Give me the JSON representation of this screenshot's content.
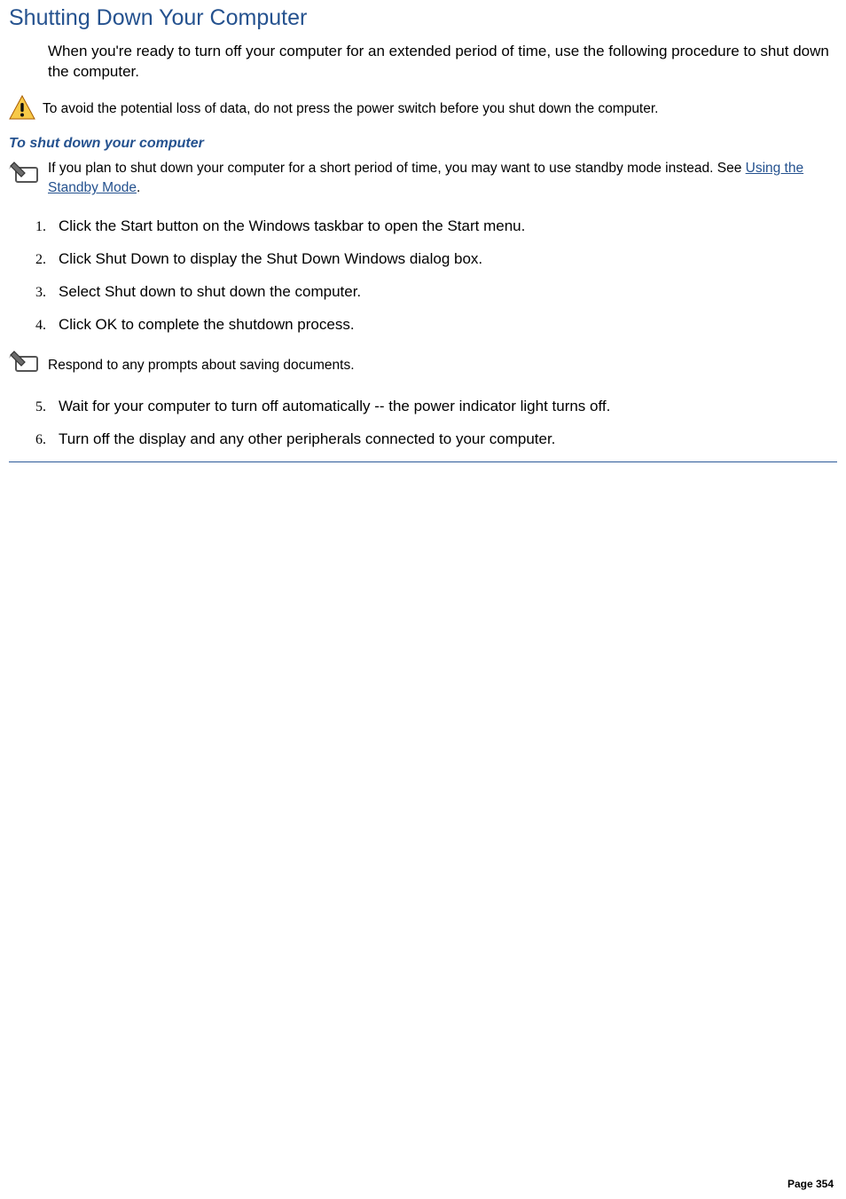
{
  "title": "Shutting Down Your Computer",
  "intro": "When you're ready to turn off your computer for an extended period of time, use the following procedure to shut down the computer.",
  "warning_text": "To avoid the potential loss of data, do not press the power switch before you shut down the computer.",
  "subhead": "To shut down your computer",
  "note1_before_link": "If you plan to shut down your computer for a short period of time, you may want to use standby mode instead. See ",
  "note1_link": "Using the Standby Mode",
  "note1_after_link": ".",
  "steps_a": [
    "Click the Start button on the Windows taskbar to open the Start menu.",
    "Click Shut Down to display the Shut Down Windows dialog box.",
    "Select Shut down to shut down the computer.",
    "Click OK to complete the shutdown process."
  ],
  "mid_note": "Respond to any prompts about saving documents.",
  "steps_b": [
    "Wait for your computer to turn off automatically -- the power indicator light turns off.",
    "Turn off the display and any other peripherals connected to your computer."
  ],
  "page_label": "Page 354",
  "icons": {
    "warning": "warning-triangle-icon",
    "note": "pencil-note-icon"
  }
}
